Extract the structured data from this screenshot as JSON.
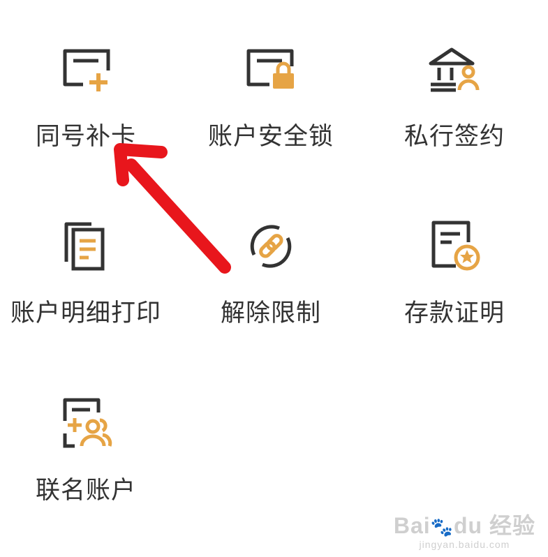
{
  "colors": {
    "dark": "#333333",
    "gold": "#E6A445",
    "arrow": "#E8161C",
    "watermark": "#cfcfcf"
  },
  "tiles": [
    {
      "label": "同号补卡",
      "icon": "card-plus-icon"
    },
    {
      "label": "账户安全锁",
      "icon": "card-lock-icon"
    },
    {
      "label": "私行签约",
      "icon": "bank-user-icon"
    },
    {
      "label": "账户明细打印",
      "icon": "documents-icon"
    },
    {
      "label": "解除限制",
      "icon": "unlink-icon"
    },
    {
      "label": "存款证明",
      "icon": "certificate-icon"
    },
    {
      "label": "联名账户",
      "icon": "joint-account-icon"
    }
  ],
  "watermark": {
    "brand": "Bai",
    "brand_tail": "du",
    "product": "经验",
    "url": "jingyan.baidu.com"
  }
}
